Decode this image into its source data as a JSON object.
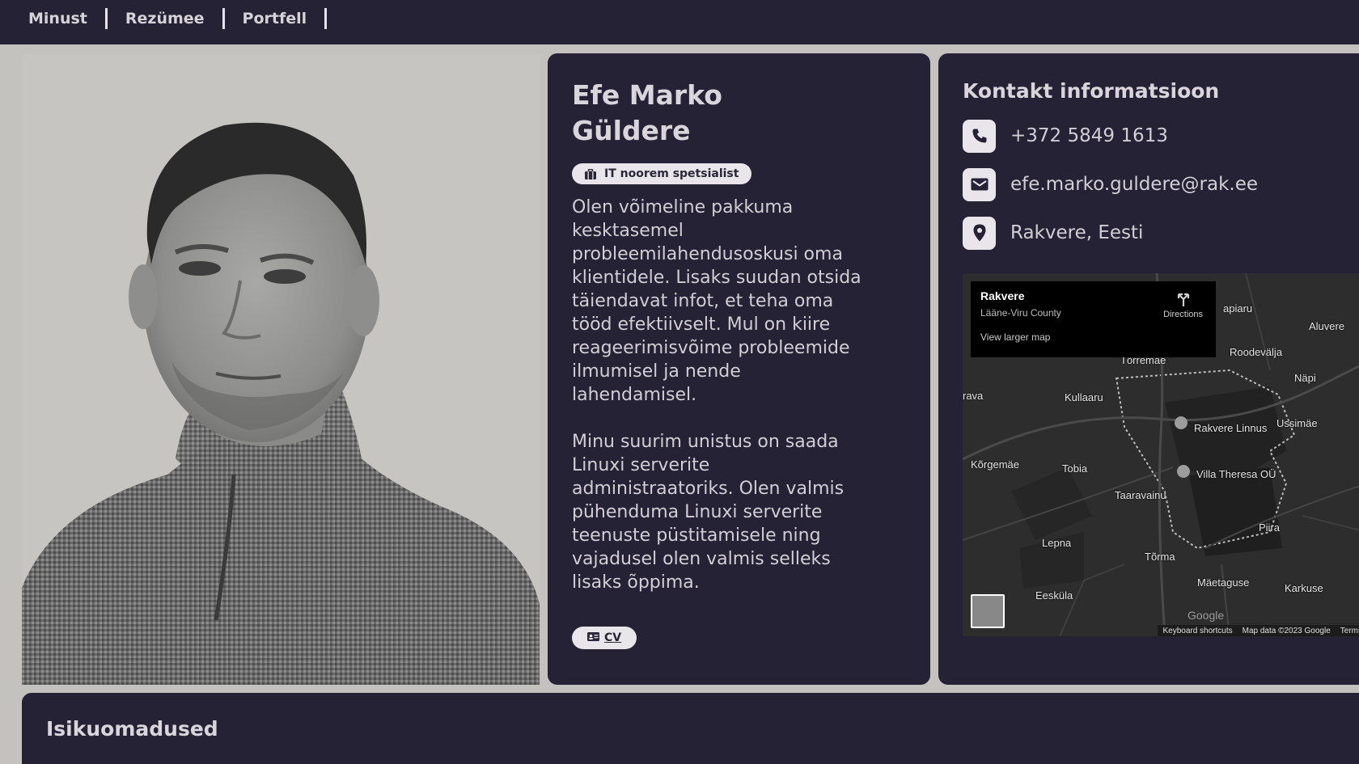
{
  "nav": {
    "items": [
      {
        "label": "Minust"
      },
      {
        "label": "Rezümee"
      },
      {
        "label": "Portfell"
      }
    ]
  },
  "profile": {
    "first_name": "Efe Marko",
    "last_name": "Güldere",
    "badge": "IT noorem spetsialist",
    "bio_1": "Olen võimeline pakkuma kesktasemel probleemilahendusoskusi oma klientidele. Lisaks suudan otsida täiendavat infot, et teha oma tööd efektiivselt. Mul on kiire reageerimisvõime probleemide ilmumisel ja nende lahendamisel.",
    "bio_2": "Minu suurim unistus on saada Linuxi serverite administraatoriks. Olen valmis pühenduma Linuxi serverite teenuste püstitamisele ning vajadusel olen valmis selleks lisaks õppima.",
    "cv_label": "CV"
  },
  "contact": {
    "title": "Kontakt informatsioon",
    "phone": "+372 5849 1613",
    "email": "efe.marko.guldere@rak.ee",
    "location": "Rakvere, Eesti"
  },
  "map": {
    "place": "Rakvere",
    "region": "Lääne-Viru County",
    "larger_map": "View larger map",
    "directions": "Directions",
    "labels": [
      "Rakvere Linnus",
      "Villa Theresa OÜ",
      "Roodevälja",
      "Aluvere",
      "Näpi",
      "Ussimäe",
      "Kullaaru",
      "Tõrremäe",
      "Kõrgemäe",
      "Tobia",
      "Taaravainu",
      "Lepna",
      "Piira",
      "Tõrma",
      "Mäetaguse",
      "Karkuse",
      "Eesküla",
      "rava",
      "apiaru"
    ],
    "footer": [
      "Keyboard shortcuts",
      "Map data ©2023 Google",
      "Terms"
    ],
    "google": "Google"
  },
  "traits": {
    "title": "Isikuomadused"
  },
  "colors": {
    "nav_bg": "#252236",
    "card_bg": "#252236",
    "page_bg": "#c3c2bf",
    "pill_bg": "#e8e6ea"
  }
}
